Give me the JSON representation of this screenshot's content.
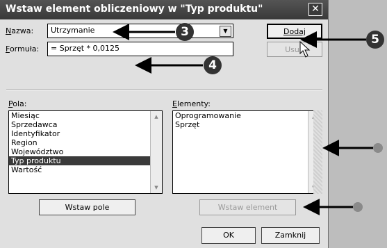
{
  "dialog": {
    "title": "Wstaw element obliczeniowy w \"Typ produktu\"",
    "close_symbol": "✕"
  },
  "nazwa": {
    "label_key": "N",
    "label_rest": "azwa:",
    "value": "Utrzymanie"
  },
  "formula": {
    "label_key": "F",
    "label_rest": "ormuła:",
    "value": "= Sprzęt * 0,0125"
  },
  "buttons": {
    "dodaj": "Dodaj",
    "usun": "Usuń",
    "wstaw_pole": "Wstaw pole",
    "wstaw_element": "Wstaw element",
    "ok": "OK",
    "zamknij": "Zamknij"
  },
  "pola": {
    "label_key": "P",
    "label_rest": "ola:",
    "items": [
      "Miesiąc",
      "Sprzedawca",
      "Identyfikator",
      "Region",
      "Województwo",
      "Typ produktu",
      "Wartość"
    ],
    "selected": "Typ produktu"
  },
  "elementy": {
    "label_key": "E",
    "label_rest": "lementy:",
    "items": [
      "Oprogramowanie",
      "Sprzęt"
    ]
  },
  "callouts": {
    "c3": "3",
    "c4": "4",
    "c5": "5"
  },
  "icons": {
    "dropdown": "chevron-down-icon",
    "cursor": "mouse-pointer-icon"
  }
}
